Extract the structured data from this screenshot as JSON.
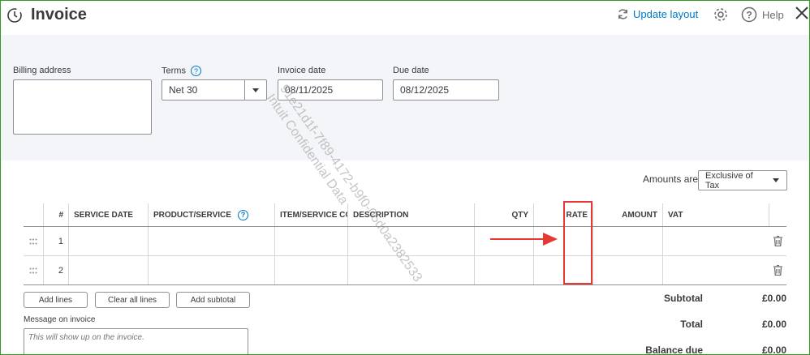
{
  "header": {
    "title": "Invoice",
    "update_layout": "Update layout",
    "help": "Help"
  },
  "form": {
    "billing_address_label": "Billing address",
    "billing_address_value": "",
    "terms_label": "Terms",
    "terms_value": "Net 30",
    "invoice_date_label": "Invoice date",
    "invoice_date_value": "08/11/2025",
    "due_date_label": "Due date",
    "due_date_value": "08/12/2025"
  },
  "amounts": {
    "label": "Amounts are",
    "value": "Exclusive of Tax"
  },
  "table": {
    "columns": [
      "#",
      "SERVICE DATE",
      "PRODUCT/SERVICE",
      "ITEM/SERVICE CO",
      "DESCRIPTION",
      "QTY",
      "RATE",
      "AMOUNT",
      "VAT"
    ],
    "rows": [
      {
        "num": "1"
      },
      {
        "num": "2"
      }
    ]
  },
  "buttons": {
    "add_lines": "Add lines",
    "clear_all_lines": "Clear all lines",
    "add_subtotal": "Add subtotal"
  },
  "message": {
    "label": "Message on invoice",
    "placeholder": "This will show up on the invoice."
  },
  "totals": {
    "subtotal_label": "Subtotal",
    "subtotal_value": "£0.00",
    "total_label": "Total",
    "total_value": "£0.00",
    "balance_label": "Balance due",
    "balance_value": "£0.00"
  },
  "watermark": {
    "line1": "91e21d1f-7f89-4172-b9f0-05d0a2382533",
    "line2": "Intuit Confidential Data"
  },
  "colors": {
    "accent": "#0077c5",
    "highlight": "#e53935",
    "frame": "#2ca01c"
  }
}
